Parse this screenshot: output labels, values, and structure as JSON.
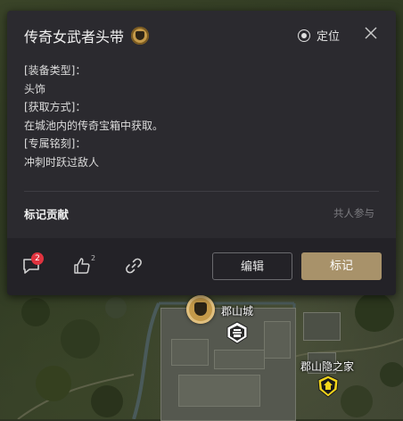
{
  "popup": {
    "title": "传奇女武者头带",
    "locate_label": "定位",
    "description_lines": [
      "[装备类型]：",
      "头饰",
      "[获取方式]：",
      "在城池内的传奇宝箱中获取。",
      "[专属铭刻]：",
      "冲刺时跃过敌人"
    ],
    "contribution_label": "标记贡献",
    "contribution_hint": "共人参与",
    "footer": {
      "comment_count": "2",
      "like_count": "2",
      "edit_label": "编辑",
      "mark_label": "标记"
    }
  },
  "map": {
    "labels": {
      "city": "郡山城",
      "home": "郡山隐之家"
    }
  },
  "colors": {
    "popup_bg": "#2b2a2f",
    "accent_gold": "#a8926a",
    "badge_red": "#e0333f"
  },
  "icons": [
    "title-helmet-icon",
    "locate-icon",
    "close-icon",
    "comment-icon",
    "like-icon",
    "share-link-icon",
    "gold-marker-icon",
    "city-marker-icon",
    "home-marker-icon"
  ]
}
